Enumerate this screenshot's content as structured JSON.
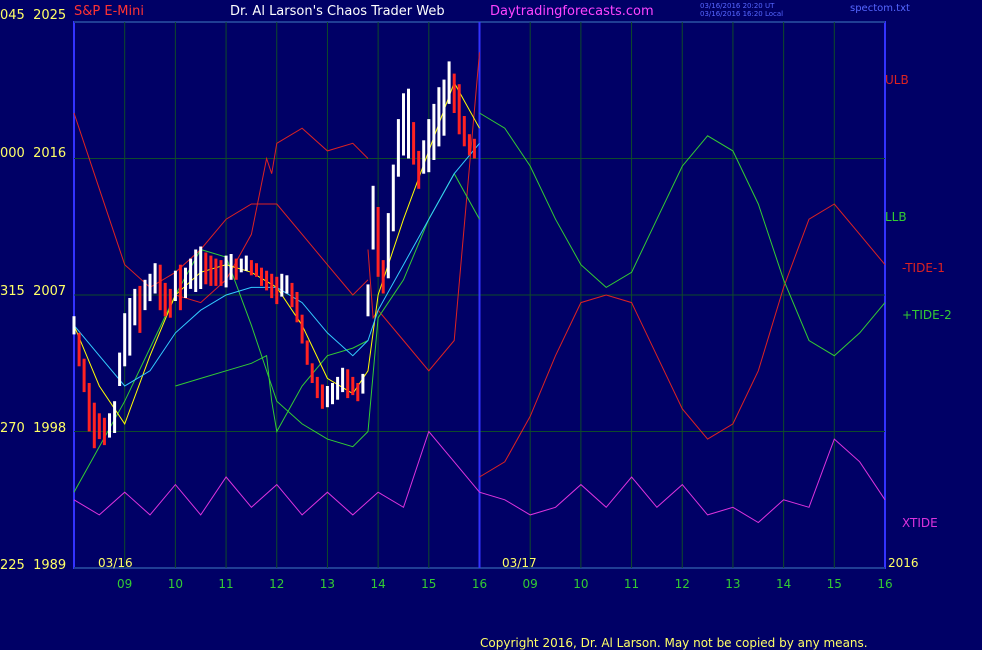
{
  "header": {
    "instrument": "S&P E-Mini",
    "site_title": "Dr. Al Larson's Chaos Trader Web",
    "site_url": "Daytradingforecasts.com",
    "timestamp_ut": "03/16/2016 20:20 UT",
    "timestamp_local": "03/16/2016 16:20 Local",
    "file_name": "spectom.txt"
  },
  "colors": {
    "background": "#000066",
    "frame": "#3333ff",
    "grid": "#0e4a2a",
    "price_up": "#ffffff",
    "price_down": "#ff2222",
    "ulb": "#dd2222",
    "llb": "#33cc33",
    "tide_fast": "#ffff00",
    "tide_avg": "#33ccff",
    "xtide": "#dd33dd",
    "axis_text": "#ffff66",
    "time_text": "#33cc33"
  },
  "right_labels": {
    "ulb": "ULB",
    "llb": "LLB",
    "tide1": "-TIDE-1",
    "tide2": "+TIDE-2",
    "xtide": "XTIDE"
  },
  "date_labels": {
    "day1": "03/16",
    "day2": "03/17",
    "year": "2016"
  },
  "copyright": "Copyright 2016, Dr. Al Larson. May not be copied by any means.",
  "chart_data": {
    "type": "line",
    "y_axis": {
      "ticks": [
        {
          "left": "045",
          "price": "2025"
        },
        {
          "left": "000",
          "price": "2016"
        },
        {
          "left": "315",
          "price": "2007"
        },
        {
          "left": "270",
          "price": "1998"
        },
        {
          "left": "225",
          "price": "1989"
        }
      ],
      "price_range": [
        1989,
        2025
      ]
    },
    "x_axis": {
      "ticks": [
        "09",
        "10",
        "11",
        "12",
        "13",
        "14",
        "15",
        "16",
        "09",
        "10",
        "11",
        "12",
        "13",
        "14",
        "15",
        "16"
      ],
      "range": [
        8,
        24
      ]
    },
    "split_at": 16,
    "price_bars": [
      [
        8.0,
        2005.6,
        2004.4
      ],
      [
        8.1,
        2004.5,
        2002.3
      ],
      [
        8.2,
        2002.8,
        2000.6
      ],
      [
        8.3,
        2001.2,
        1998.0
      ],
      [
        8.4,
        1999.9,
        1996.9
      ],
      [
        8.5,
        1999.2,
        1997.5
      ],
      [
        8.6,
        1998.9,
        1997.1
      ],
      [
        8.7,
        1999.2,
        1997.6
      ],
      [
        8.8,
        2000.0,
        1997.9
      ],
      [
        8.9,
        2003.2,
        2001.0
      ],
      [
        9.0,
        2005.8,
        2002.3
      ],
      [
        9.1,
        2006.8,
        2003.0
      ],
      [
        9.2,
        2007.4,
        2005.0
      ],
      [
        9.3,
        2007.6,
        2004.5
      ],
      [
        9.4,
        2008.0,
        2006.0
      ],
      [
        9.5,
        2008.4,
        2006.6
      ],
      [
        9.6,
        2009.1,
        2007.1
      ],
      [
        9.7,
        2009.0,
        2006.0
      ],
      [
        9.8,
        2007.8,
        2005.6
      ],
      [
        9.9,
        2007.4,
        2005.5
      ],
      [
        10.0,
        2008.6,
        2006.6
      ],
      [
        10.1,
        2009.0,
        2006.0
      ],
      [
        10.2,
        2008.8,
        2006.8
      ],
      [
        10.3,
        2009.4,
        2007.4
      ],
      [
        10.4,
        2010.0,
        2007.2
      ],
      [
        10.5,
        2010.2,
        2007.4
      ],
      [
        10.6,
        2009.8,
        2007.7
      ],
      [
        10.7,
        2009.6,
        2007.6
      ],
      [
        10.8,
        2009.4,
        2007.6
      ],
      [
        10.9,
        2009.3,
        2007.6
      ],
      [
        11.0,
        2009.6,
        2007.5
      ],
      [
        11.1,
        2009.7,
        2008.0
      ],
      [
        11.2,
        2009.4,
        2008.0
      ],
      [
        11.3,
        2009.4,
        2008.5
      ],
      [
        11.4,
        2009.6,
        2008.6
      ],
      [
        11.5,
        2009.3,
        2008.3
      ],
      [
        11.6,
        2009.1,
        2008.2
      ],
      [
        11.7,
        2008.8,
        2007.6
      ],
      [
        11.8,
        2008.6,
        2007.3
      ],
      [
        11.9,
        2008.4,
        2006.8
      ],
      [
        12.0,
        2008.2,
        2006.4
      ],
      [
        12.1,
        2008.4,
        2006.9
      ],
      [
        12.2,
        2008.3,
        2007.1
      ],
      [
        12.3,
        2007.8,
        2006.2
      ],
      [
        12.4,
        2007.2,
        2005.2
      ],
      [
        12.5,
        2005.7,
        2003.8
      ],
      [
        12.6,
        2004.0,
        2002.4
      ],
      [
        12.7,
        2002.5,
        2001.2
      ],
      [
        12.8,
        2001.6,
        2000.2
      ],
      [
        12.9,
        2001.1,
        1999.5
      ],
      [
        13.0,
        2001.0,
        1999.6
      ],
      [
        13.1,
        2001.2,
        1999.8
      ],
      [
        13.2,
        2001.6,
        2000.1
      ],
      [
        13.3,
        2002.2,
        2000.6
      ],
      [
        13.4,
        2002.1,
        2000.2
      ],
      [
        13.5,
        2001.6,
        2000.4
      ],
      [
        13.6,
        2001.2,
        2000.0
      ],
      [
        13.7,
        2001.8,
        2000.5
      ],
      [
        13.8,
        2007.7,
        2005.6
      ],
      [
        13.9,
        2014.2,
        2010.0
      ],
      [
        14.0,
        2012.8,
        2008.2
      ],
      [
        14.1,
        2009.3,
        2007.1
      ],
      [
        14.2,
        2012.4,
        2008.1
      ],
      [
        14.3,
        2015.6,
        2011.2
      ],
      [
        14.4,
        2018.6,
        2014.8
      ],
      [
        14.5,
        2020.3,
        2016.2
      ],
      [
        14.6,
        2020.6,
        2016.0
      ],
      [
        14.7,
        2018.4,
        2015.6
      ],
      [
        14.8,
        2016.5,
        2014.0
      ],
      [
        14.9,
        2017.2,
        2015.0
      ],
      [
        15.0,
        2018.6,
        2015.1
      ],
      [
        15.1,
        2019.6,
        2015.9
      ],
      [
        15.2,
        2020.7,
        2016.8
      ],
      [
        15.3,
        2021.2,
        2017.5
      ],
      [
        15.4,
        2022.4,
        2019.6
      ],
      [
        15.5,
        2021.6,
        2019.0
      ],
      [
        15.6,
        2020.9,
        2017.6
      ],
      [
        15.7,
        2018.8,
        2016.8
      ],
      [
        15.8,
        2017.6,
        2016.2
      ],
      [
        15.9,
        2017.3,
        2016.0
      ]
    ],
    "series": [
      {
        "key": "ulb1",
        "role": "ulb",
        "x": [
          8.0,
          8.5,
          9.0,
          9.5,
          10.0,
          10.5,
          11.0,
          11.5,
          12.0,
          12.5,
          13.0,
          13.5,
          13.8
        ],
        "y": [
          2019,
          2014,
          2009,
          2007.5,
          2008.5,
          2010,
          2012,
          2013,
          2013,
          2011,
          2009,
          2007,
          2008
        ]
      },
      {
        "key": "ulb2",
        "role": "ulb",
        "x": [
          10.0,
          10.5,
          11.0,
          11.5,
          11.8,
          11.9,
          12.0,
          12.5,
          13.0,
          13.5,
          13.8
        ],
        "y": [
          2007,
          2006.5,
          2008,
          2011,
          2016,
          2015,
          2017,
          2018,
          2016.5,
          2017,
          2016
        ]
      },
      {
        "key": "ulb_open",
        "role": "ulb",
        "x": [
          13.8,
          13.9,
          14.0,
          14.5,
          15.0,
          15.5,
          16.0
        ],
        "y": [
          2010,
          2005.5,
          2006,
          2004,
          2002,
          2004,
          2023
        ]
      },
      {
        "key": "llb1",
        "role": "llb",
        "x": [
          8.0,
          8.5,
          9.0,
          9.5,
          10.0,
          10.5,
          11.0,
          11.5,
          12.0,
          12.5,
          13.0,
          13.5,
          13.8
        ],
        "y": [
          1994,
          1997,
          2000,
          2003.5,
          2007,
          2010,
          2009.5,
          2005,
          2000,
          1998.5,
          1997.5,
          1997,
          1998
        ]
      },
      {
        "key": "llb2",
        "role": "llb",
        "x": [
          10.0,
          10.5,
          11.0,
          11.5,
          11.8,
          11.9,
          12.0,
          12.5,
          13.0,
          13.5,
          13.8
        ],
        "y": [
          2001,
          2001.5,
          2002,
          2002.5,
          2003,
          2000,
          1998,
          2001,
          2003,
          2003.5,
          2004
        ]
      },
      {
        "key": "llb_open",
        "role": "llb",
        "x": [
          13.8,
          14.0,
          14.5,
          15.0,
          15.5,
          16.0
        ],
        "y": [
          1998,
          2005.5,
          2008,
          2012,
          2015,
          2012
        ]
      },
      {
        "key": "tide_fast",
        "role": "tide_fast",
        "x": [
          8.0,
          8.5,
          9.0,
          9.5,
          10.0,
          10.5,
          11.0,
          11.5,
          12.0,
          12.5,
          13.0,
          13.5,
          13.8,
          14.0,
          14.5,
          15.0,
          15.5,
          16.0
        ],
        "y": [
          2005,
          2001,
          1998.5,
          2003,
          2007,
          2008.5,
          2009,
          2008.5,
          2007.5,
          2005,
          2001.5,
          2000.5,
          2002,
          2007,
          2012,
          2016.5,
          2021,
          2018
        ]
      },
      {
        "key": "tide_avg",
        "role": "tide_avg",
        "x": [
          8.0,
          8.5,
          9.0,
          9.5,
          10.0,
          10.5,
          11.0,
          11.5,
          12.0,
          12.5,
          13.0,
          13.5,
          13.8,
          14.0,
          14.5,
          15.0,
          15.5,
          16.0
        ],
        "y": [
          2005,
          2003,
          2001,
          2002,
          2004.5,
          2006,
          2007,
          2007.5,
          2007.5,
          2006.5,
          2004.5,
          2003,
          2004,
          2006,
          2009,
          2012,
          2015,
          2017
        ]
      },
      {
        "key": "tide1",
        "role": "tide1",
        "x": [
          16.0,
          16.5,
          17.0,
          17.5,
          18.0,
          18.5,
          19.0,
          19.5,
          20.0,
          20.5,
          21.0,
          21.5,
          22.0,
          22.5,
          23.0,
          23.5,
          24.0
        ],
        "y": [
          1995,
          1996,
          1999,
          2003,
          2006.5,
          2007,
          2006.5,
          2003,
          1999.5,
          1997.5,
          1998.5,
          2002,
          2007.5,
          2012,
          2013,
          2011,
          2009
        ]
      },
      {
        "key": "tide2",
        "role": "tide2",
        "x": [
          16.0,
          16.5,
          17.0,
          17.5,
          18.0,
          18.5,
          19.0,
          19.5,
          20.0,
          20.5,
          21.0,
          21.5,
          22.0,
          22.5,
          23.0,
          23.5,
          24.0
        ],
        "y": [
          2019,
          2018,
          2015.5,
          2012,
          2009,
          2007.5,
          2008.5,
          2012,
          2015.5,
          2017.5,
          2016.5,
          2013,
          2008,
          2004,
          2003,
          2004.5,
          2006.5
        ]
      }
    ],
    "xtide": {
      "offset": 0,
      "amplitude": 1,
      "x": [
        8.0,
        8.5,
        9.0,
        9.5,
        10.0,
        10.5,
        11.0,
        11.5,
        12.0,
        12.5,
        13.0,
        13.5,
        14.0,
        14.5,
        15.0,
        15.5,
        16.0,
        16.5,
        17.0,
        17.5,
        18.0,
        18.5,
        19.0,
        19.5,
        20.0,
        20.5,
        21.0,
        21.5,
        22.0,
        22.5,
        23.0,
        23.5,
        24.0
      ],
      "y": [
        1993.5,
        1992.5,
        1994,
        1992.5,
        1994.5,
        1992.5,
        1995,
        1993,
        1994.5,
        1992.5,
        1994,
        1992.5,
        1994,
        1993,
        1998,
        1996,
        1994,
        1993.5,
        1992.5,
        1993,
        1994.5,
        1993,
        1995,
        1993,
        1994.5,
        1992.5,
        1993,
        1992,
        1993.5,
        1993,
        1997.5,
        1996,
        1993.5
      ]
    }
  }
}
